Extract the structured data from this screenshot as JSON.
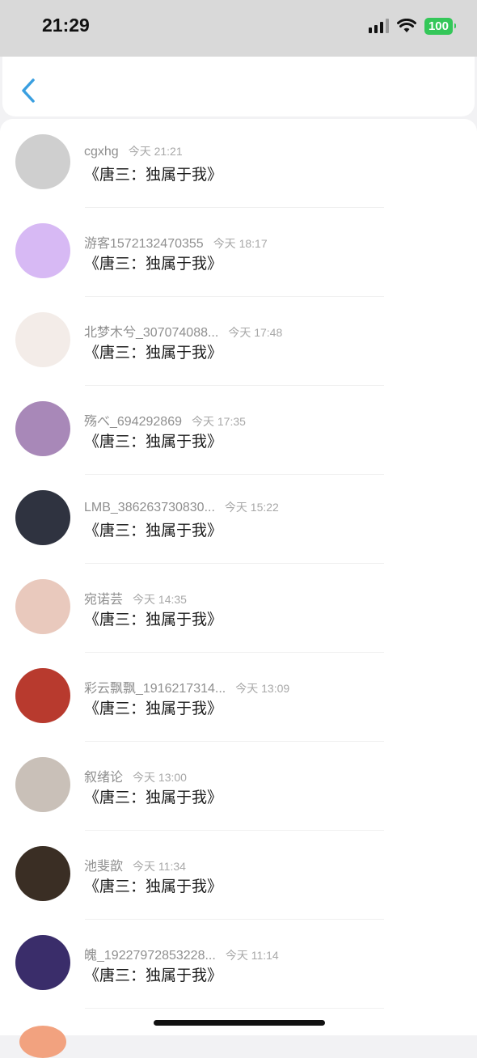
{
  "status_bar": {
    "time": "21:29",
    "battery": "100",
    "icons": [
      "signal-icon",
      "wifi-icon",
      "battery-icon"
    ]
  },
  "nav": {
    "back_icon": "chevron-left-icon",
    "accent_color": "#3a9fe0"
  },
  "messages": [
    {
      "name": "cgxhg",
      "time": "今天 21:21",
      "text": "《唐三：独属于我》",
      "avatar_color": "#cfcfcf"
    },
    {
      "name": "游客1572132470355",
      "time": "今天 18:17",
      "text": "《唐三：独属于我》",
      "avatar_color": "#d7b9f4"
    },
    {
      "name": "北梦木兮_307074088...",
      "time": "今天 17:48",
      "text": "《唐三：独属于我》",
      "avatar_color": "#f3ece8"
    },
    {
      "name": "殇べ_694292869",
      "time": "今天 17:35",
      "text": "《唐三：独属于我》",
      "avatar_color": "#a888b8"
    },
    {
      "name": "LMB_386263730830...",
      "time": "今天 15:22",
      "text": "《唐三：独属于我》",
      "avatar_color": "#2f3340"
    },
    {
      "name": "宛诺芸",
      "time": "今天 14:35",
      "text": "《唐三：独属于我》",
      "avatar_color": "#e9c9bd"
    },
    {
      "name": "彩云飘飘_1916217314...",
      "time": "今天 13:09",
      "text": "《唐三：独属于我》",
      "avatar_color": "#b83a2e"
    },
    {
      "name": "叙绪论",
      "time": "今天 13:00",
      "text": "《唐三：独属于我》",
      "avatar_color": "#c9c0b8"
    },
    {
      "name": "池斐歆",
      "time": "今天 11:34",
      "text": "《唐三：独属于我》",
      "avatar_color": "#3a2e24"
    },
    {
      "name": "魄_19227972853228...",
      "time": "今天 11:14",
      "text": "《唐三：独属于我》",
      "avatar_color": "#3a2d6a"
    }
  ]
}
